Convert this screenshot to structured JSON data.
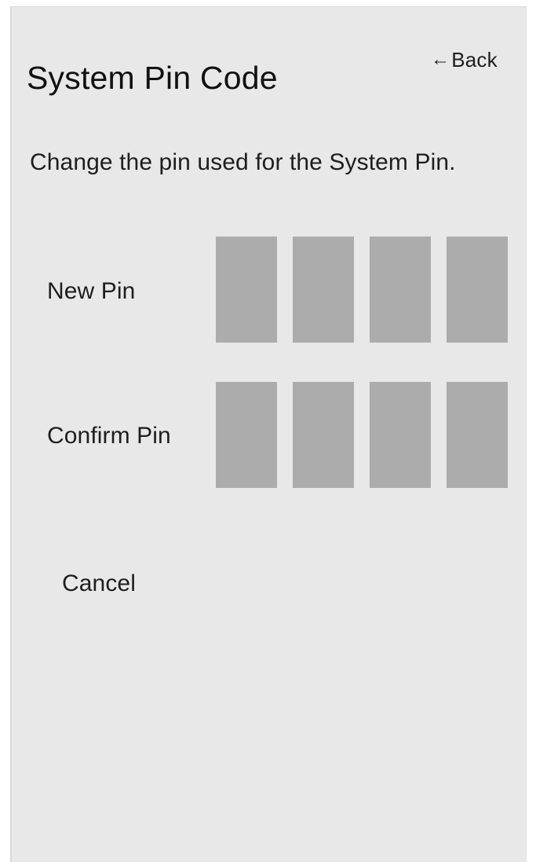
{
  "header": {
    "back_arrow": "←",
    "back_label": "Back",
    "title": "System Pin Code"
  },
  "description": "Change the pin used for the System Pin.",
  "new_pin": {
    "label": "New Pin",
    "digits": [
      "",
      "",
      "",
      ""
    ]
  },
  "confirm_pin": {
    "label": "Confirm Pin",
    "digits": [
      "",
      "",
      "",
      ""
    ]
  },
  "actions": {
    "cancel_label": "Cancel"
  },
  "colors": {
    "panel_background": "#e8e8e8",
    "pin_box": "#acacac",
    "text": "#1e1e1e"
  }
}
